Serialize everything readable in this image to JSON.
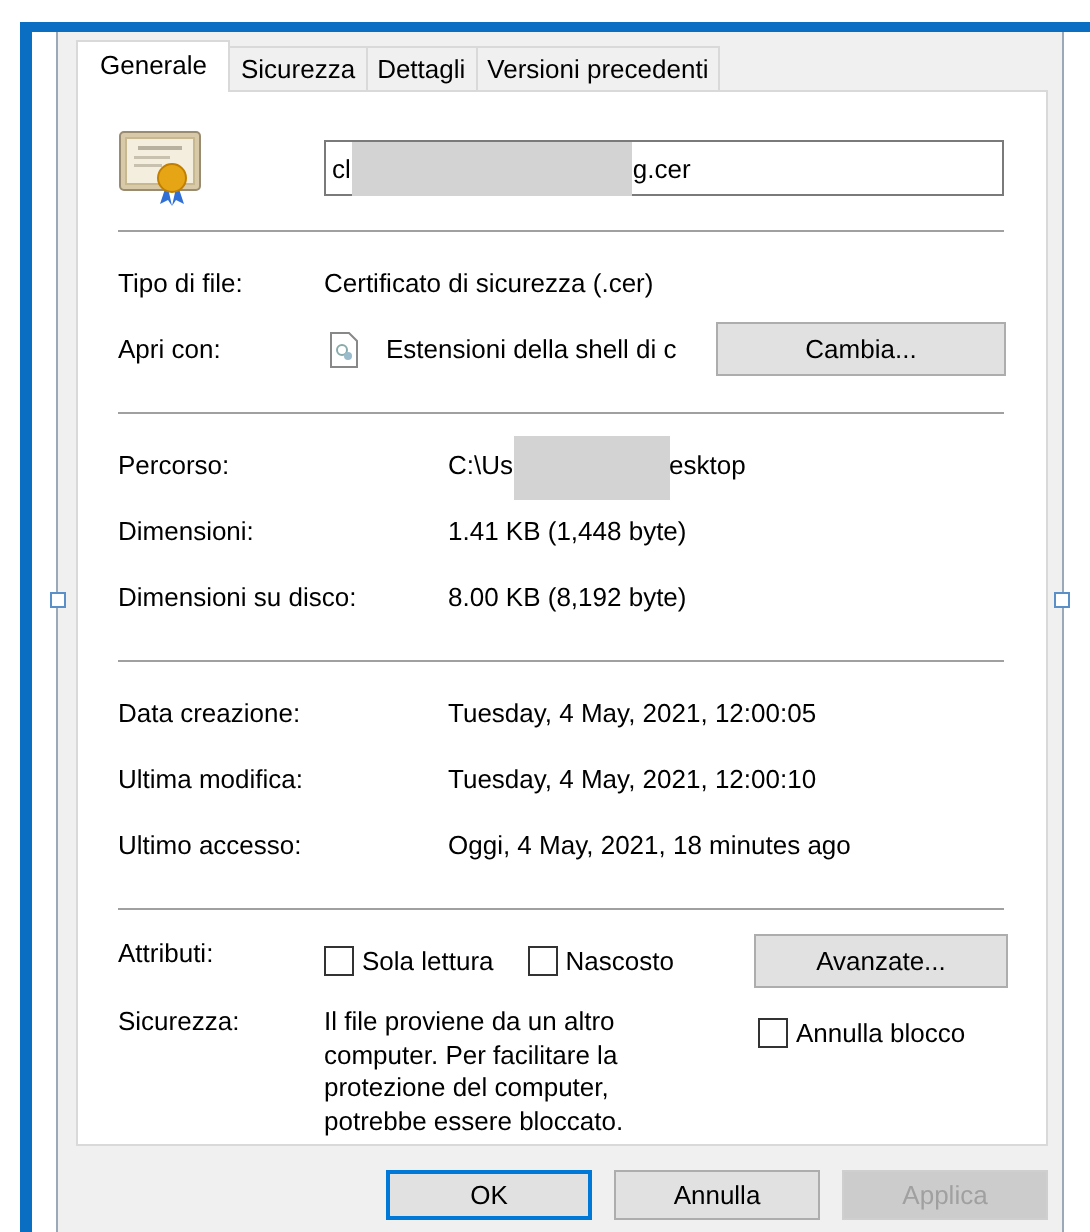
{
  "tabs": [
    {
      "label": "Generale",
      "selected": true
    },
    {
      "label": "Sicurezza",
      "selected": false
    },
    {
      "label": "Dettagli",
      "selected": false
    },
    {
      "label": "Versioni precedenti",
      "selected": false
    }
  ],
  "file": {
    "name_start": "cl",
    "name_end": "g.cer"
  },
  "type": {
    "label": "Tipo di file:",
    "value": "Certificato di sicurezza (.cer)"
  },
  "open_with": {
    "label": "Apri con:",
    "app": "Estensioni della shell di c",
    "button": "Cambia..."
  },
  "location": [
    {
      "label": "Percorso:",
      "kind": "redacted",
      "value_start": "C:\\Us",
      "value_end": "esktop"
    },
    {
      "label": "Dimensioni:",
      "kind": "text",
      "value": "1.41 KB (1,448 byte)"
    },
    {
      "label": "Dimensioni su disco:",
      "kind": "text",
      "value": "8.00 KB (8,192 byte)"
    }
  ],
  "dates": [
    {
      "label": "Data creazione:",
      "value": "Tuesday, 4 May, 2021, 12:00:05"
    },
    {
      "label": "Ultima modifica:",
      "value": "Tuesday, 4 May, 2021, 12:00:10"
    },
    {
      "label": "Ultimo accesso:",
      "value": "Oggi, 4 May, 2021, 18 minutes ago"
    }
  ],
  "attributes": {
    "label": "Attributi:",
    "options": [
      {
        "label": "Sola lettura",
        "checked": false
      },
      {
        "label": "Nascosto",
        "checked": false
      }
    ],
    "button": "Avanzate..."
  },
  "security": {
    "label": "Sicurezza:",
    "text": "Il file proviene da un altro computer. Per facilitare la protezione del computer, potrebbe essere bloccato.",
    "unblock": {
      "label": "Annulla blocco",
      "checked": false
    }
  },
  "buttons": [
    {
      "label": "OK",
      "default": true,
      "disabled": false
    },
    {
      "label": "Annulla",
      "default": false,
      "disabled": false
    },
    {
      "label": "Applica",
      "default": false,
      "disabled": true
    }
  ]
}
